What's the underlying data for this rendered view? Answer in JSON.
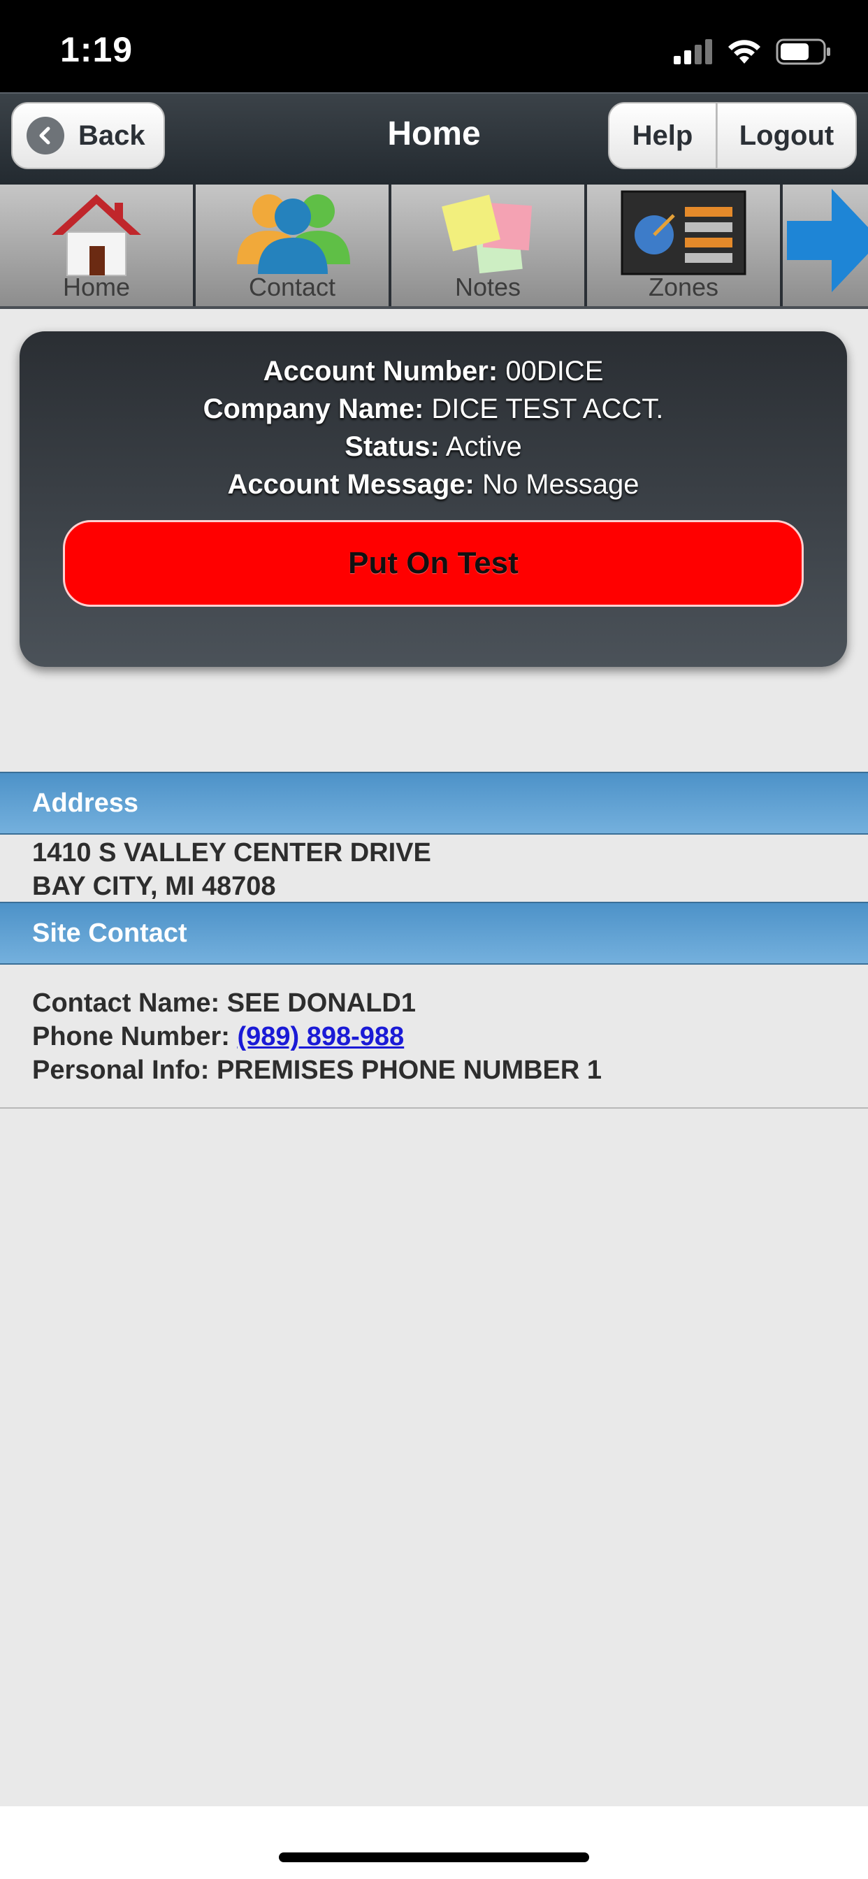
{
  "status_bar": {
    "time": "1:19"
  },
  "header": {
    "back_label": "Back",
    "title": "Home",
    "help_label": "Help",
    "logout_label": "Logout"
  },
  "toolbar": {
    "items": [
      {
        "label": "Home",
        "icon": "house-icon"
      },
      {
        "label": "Contact",
        "icon": "contacts-icon"
      },
      {
        "label": "Notes",
        "icon": "sticky-notes-icon"
      },
      {
        "label": "Zones",
        "icon": "zones-icon"
      }
    ],
    "next_icon": "right-arrow-icon"
  },
  "account": {
    "number_label": "Account Number:",
    "number_value": "00DICE",
    "company_label": "Company Name:",
    "company_value": "DICE TEST ACCT.",
    "status_label": "Status:",
    "status_value": "Active",
    "message_label": "Account Message:",
    "message_value": "No Message",
    "test_button": "Put On Test"
  },
  "address": {
    "heading": "Address",
    "line1": "1410 S VALLEY CENTER DRIVE",
    "line2": "BAY CITY, MI 48708"
  },
  "site_contact": {
    "heading": "Site Contact",
    "contact_label": "Contact Name:",
    "contact_value": "SEE DONALD1",
    "phone_label": "Phone Number:",
    "phone_value": "(989) 898-988",
    "info_label": "Personal Info:",
    "info_value": "PREMISES PHONE NUMBER 1"
  },
  "colors": {
    "test_button": "#ff0000",
    "section_header": "#5fa0d3",
    "link": "#1a1ad6"
  }
}
